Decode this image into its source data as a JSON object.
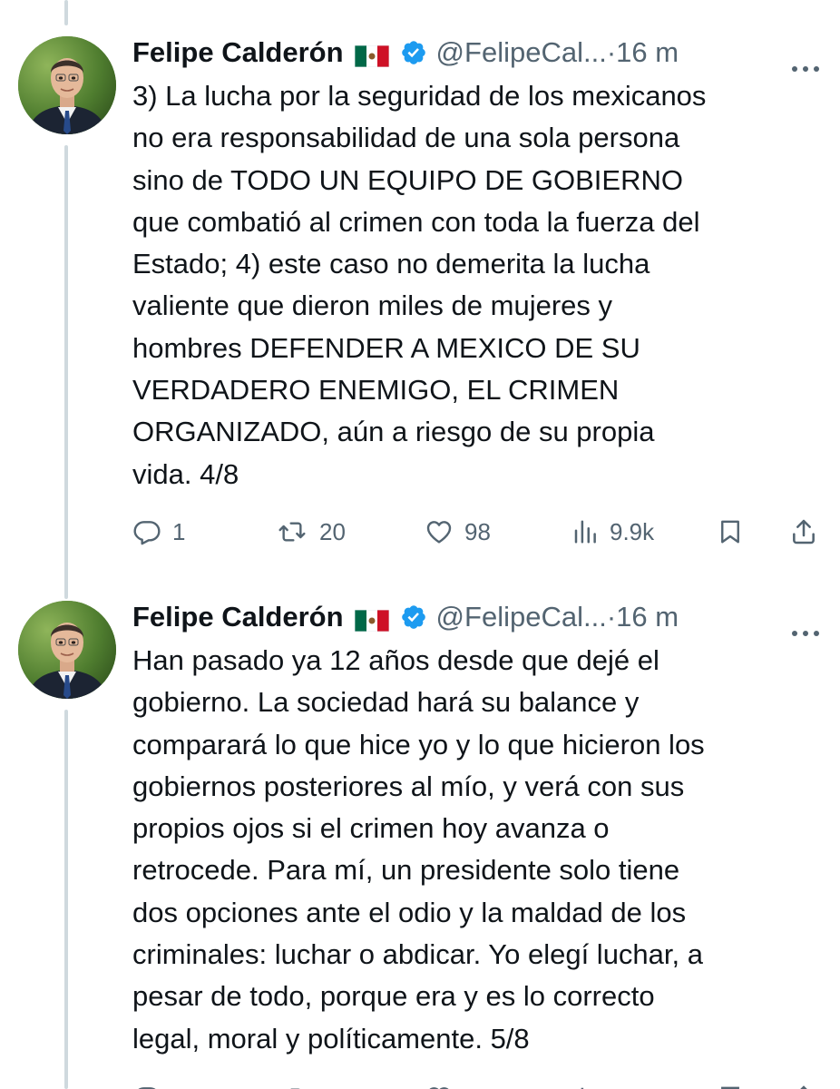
{
  "colors": {
    "text": "#0f1419",
    "secondary": "#536471",
    "verified_blue": "#1d9bf0",
    "thread_line": "#cfd9de"
  },
  "tweets": [
    {
      "author_name": "Felipe Calderón",
      "flag_icon": "mexico-flag-icon",
      "verified_icon": "verified-badge-icon",
      "handle": "@FelipeCal...",
      "separator": "·",
      "time": "16 m",
      "more_icon": "more-options-icon",
      "text": "3) La lucha por la seguridad de los mexicanos\nno era responsabilidad de una sola persona\nsino de TODO UN EQUIPO DE GOBIERNO\nque combatió al crimen con toda la fuerza del\nEstado; 4) este caso no demerita la lucha\nvaliente que dieron miles de mujeres y\nhombres DEFENDER A MEXICO DE SU\nVERDADERO ENEMIGO, EL CRIMEN\nORGANIZADO, aún a riesgo de su propia\nvida. 4/8",
      "actions": {
        "replies": "1",
        "retweets": "20",
        "likes": "98",
        "views": "9.9k"
      }
    },
    {
      "author_name": "Felipe Calderón",
      "flag_icon": "mexico-flag-icon",
      "verified_icon": "verified-badge-icon",
      "handle": "@FelipeCal...",
      "separator": "·",
      "time": "16 m",
      "more_icon": "more-options-icon",
      "text": "Han pasado ya 12 años desde que dejé el\ngobierno. La sociedad hará su balance y\ncomparará lo que hice yo y lo que hicieron los\ngobiernos posteriores al mío, y verá con sus\npropios ojos si el crimen hoy avanza o\nretrocede. Para mí, un presidente solo tiene\ndos opciones ante el odio y la maldad de los\ncriminales: luchar o abdicar. Yo elegí luchar, a\npesar de todo, porque era y es lo correcto\nlegal, moral y políticamente. 5/8"
    }
  ]
}
